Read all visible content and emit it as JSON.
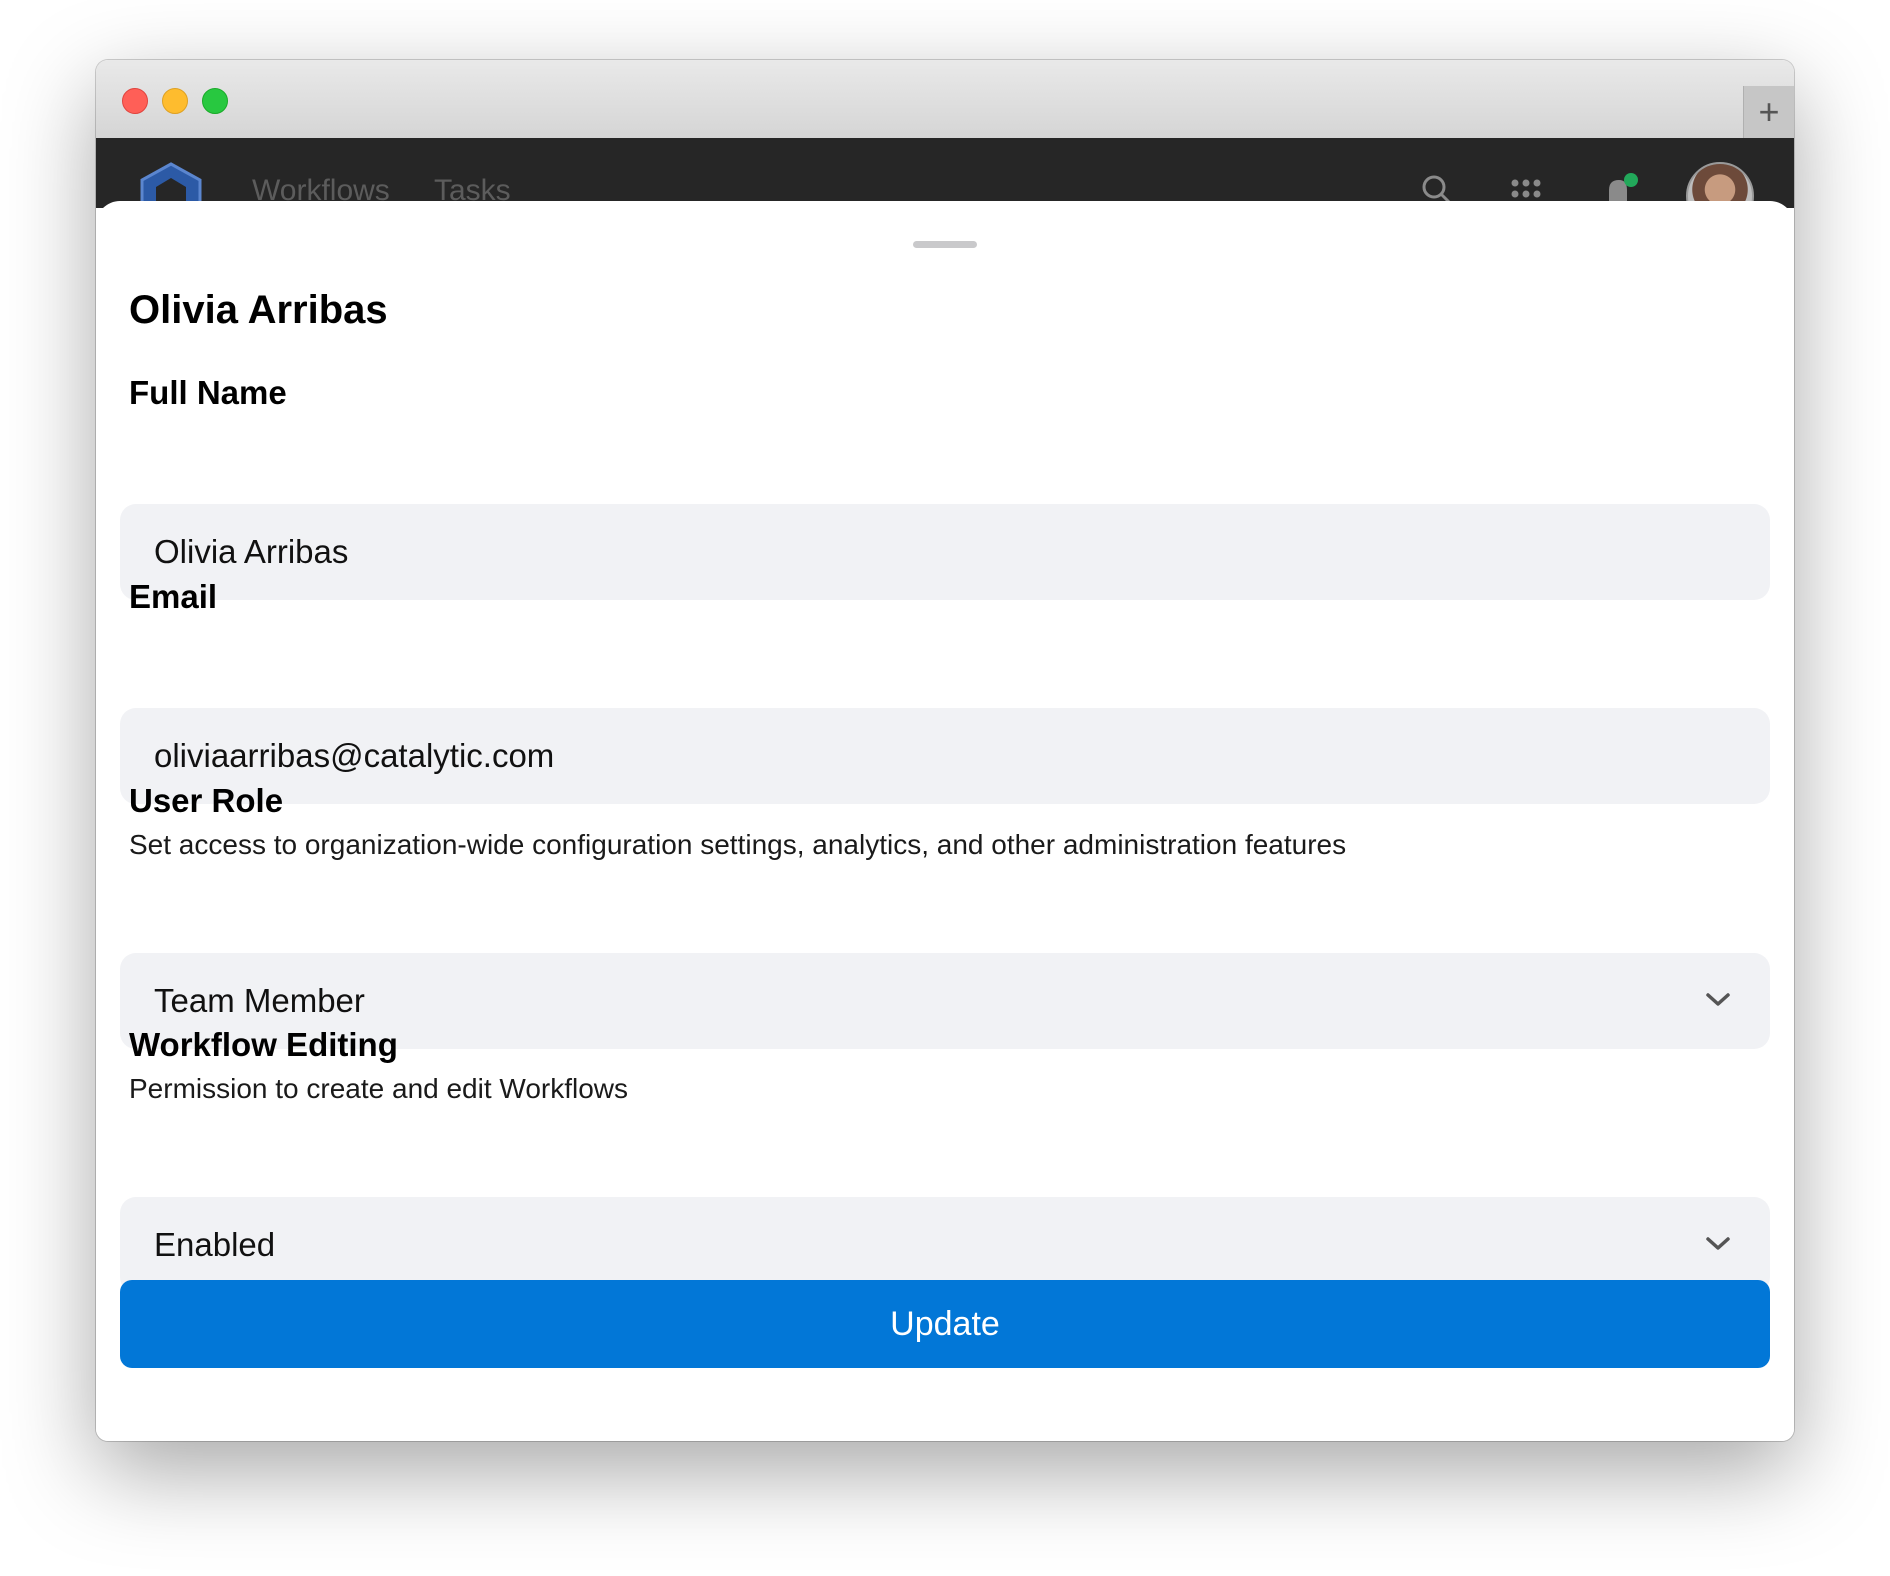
{
  "window": {
    "new_tab_symbol": "+"
  },
  "appbar": {
    "nav": [
      "Workflows",
      "Tasks"
    ],
    "icons": [
      "hexagon-logo-icon",
      "search-icon",
      "apps-grid-icon",
      "bell-icon",
      "avatar"
    ],
    "notification_color": "#22a85a"
  },
  "sheet": {
    "title": "Olivia Arribas",
    "full_name": {
      "label": "Full Name",
      "value": "Olivia Arribas"
    },
    "email": {
      "label": "Email",
      "value": "oliviaarribas@catalytic.com"
    },
    "user_role": {
      "label": "User Role",
      "description": "Set access to organization-wide configuration settings, analytics, and other administration features",
      "value": "Team Member",
      "icon": "chevron-down-icon"
    },
    "workflow_editing": {
      "label": "Workflow Editing",
      "description": "Permission to create and edit Workflows",
      "value": "Enabled",
      "icon": "chevron-down-icon"
    },
    "submit_label": "Update"
  },
  "colors": {
    "accent": "#0277d7",
    "field_background": "#f1f2f5",
    "header_background": "#262626"
  }
}
